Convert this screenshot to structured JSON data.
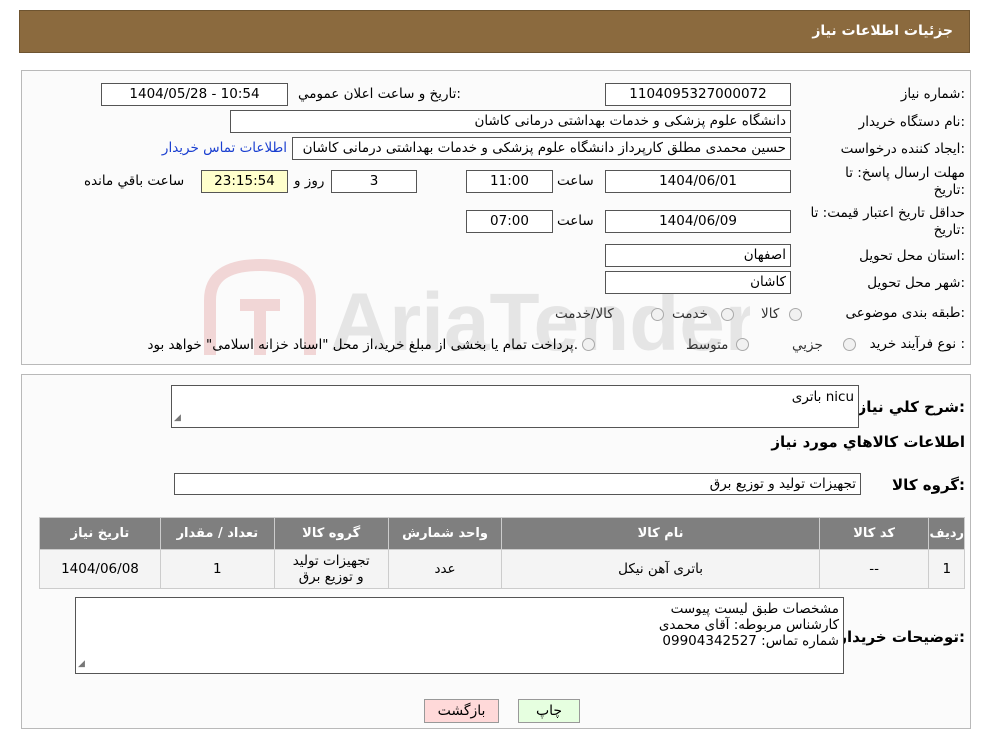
{
  "header": {
    "title": "جزئیات اطلاعات نیاز"
  },
  "watermark": {
    "text": "AriaTender.neT"
  },
  "form": {
    "need_number_label": "شماره نیاز:",
    "need_number": "1104095327000072",
    "announce_label": "تاریخ و ساعت اعلان عمومي:",
    "announce_value": "1404/05/28 - 10:54",
    "buyer_org_label": "نام دستگاه خریدار:",
    "buyer_org": "دانشگاه علوم پزشکی و خدمات بهداشتی درمانی کاشان",
    "creator_label": "ایجاد کننده درخواست:",
    "creator": "حسین محمدی مطلق کارپرداز دانشگاه علوم پزشکی و خدمات بهداشتی درمانی کاشان",
    "contact_link": "اطلاعات تماس خریدار",
    "deadline_label_1": "مهلت ارسال پاسخ: تا",
    "deadline_label_2": "تاریخ:",
    "deadline_date": "1404/06/01",
    "time_label": "ساعت",
    "deadline_time": "11:00",
    "days_value": "3",
    "days_label": "روز و",
    "remaining_time": "23:15:54",
    "remaining_label": "ساعت باقي مانده",
    "validity_label_1": "حداقل تاریخ اعتبار قیمت: تا",
    "validity_label_2": "تاریخ:",
    "validity_date": "1404/06/09",
    "validity_time": "07:00",
    "province_label": "استان محل تحویل:",
    "province": "اصفهان",
    "city_label": "شهر محل تحویل:",
    "city": "کاشان",
    "category_label": "طبقه بندی موضوعی:",
    "category_options": [
      "کالا",
      "خدمت",
      "کالا/خدمت"
    ],
    "purchase_type_label": "نوع فرآیند خرید :",
    "purchase_options": [
      "جزیي",
      "متوسط"
    ],
    "purchase_note": "پرداخت تمام یا بخشی از مبلغ خرید،از محل \"اسناد خزانه اسلامی\" خواهد بود."
  },
  "details": {
    "summary_label": "شرح کلي نیاز:",
    "summary": "باتری nicu",
    "goods_info_title": "اطلاعات کالاهاي مورد نیاز",
    "goods_group_label": "گروه کالا:",
    "goods_group": "تجهیزات تولید و توزیع برق",
    "table_headers": [
      "ردیف",
      "کد کالا",
      "نام کالا",
      "واحد شمارش",
      "گروه کالا",
      "تعداد / مقدار",
      "تاریخ نیاز"
    ],
    "table_rows": [
      [
        "1",
        "--",
        "باتری آهن نیکل",
        "عدد",
        "تجهیزات تولید و توزیع برق",
        "1",
        "1404/06/08"
      ]
    ],
    "buyer_notes_label": "توضیحات خریدار:",
    "buyer_notes": [
      "مشخصات طبق لیست پیوست",
      "کارشناس مربوطه: آقای محمدی",
      "شماره تماس: 09904342527"
    ]
  },
  "buttons": {
    "print": "چاپ",
    "back": "بازگشت"
  }
}
